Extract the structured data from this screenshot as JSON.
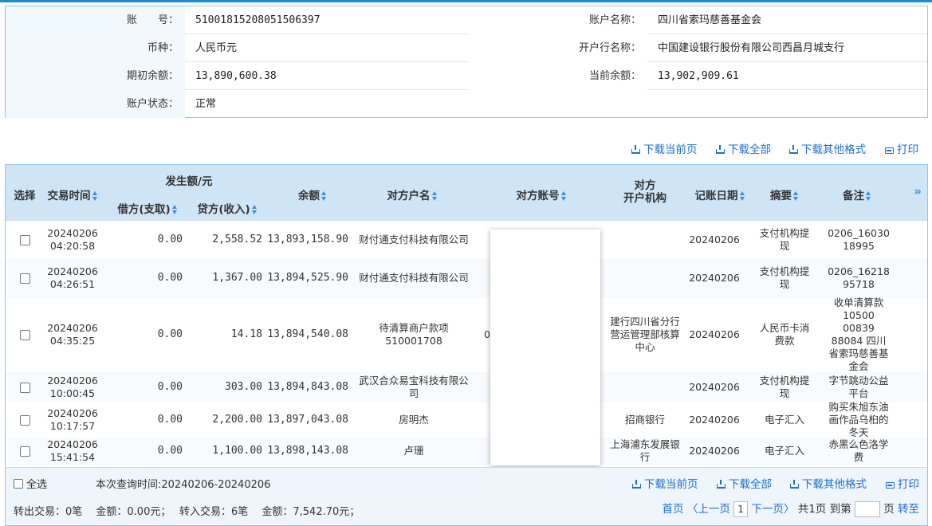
{
  "account": {
    "no_label": "账　　号：",
    "no_value": "51001815208051506397",
    "name_label": "账户名称：",
    "name_value": "四川省索玛慈善基金会",
    "currency_label": "币种：",
    "currency_value": "人民币元",
    "bank_label": "开户行名称：",
    "bank_value": "中国建设银行股份有限公司西昌月城支行",
    "opening_label": "期初余额：",
    "opening_value": "13,890,600.38",
    "current_label": "当前余额：",
    "current_value": "13,902,909.61",
    "status_label": "账户状态：",
    "status_value": "正常"
  },
  "toolbar": {
    "download_page": "下载当前页",
    "download_all": "下载全部",
    "download_other": "下载其他格式",
    "print": "打印"
  },
  "table": {
    "headers": {
      "select": "选择",
      "time": "交易时间",
      "amount_group": "发生额/元",
      "debit": "借方(支取)",
      "credit": "贷方(收入)",
      "balance": "余额",
      "party_name": "对方户名",
      "party_account": "对方账号",
      "party_bank_1": "对方",
      "party_bank_2": "开户机构",
      "post_date": "记账日期",
      "summary": "摘要",
      "remark": "备注",
      "expand": "»"
    },
    "rows": [
      {
        "date": "20240206",
        "time": "04:20:58",
        "debit": "0.00",
        "credit": "2,558.52",
        "balance": "13,893,158.90",
        "party": "财付通支付科技有限公司",
        "account": "",
        "bank": "",
        "post": "20240206",
        "summary": "支付机构提现",
        "remark": "0206_16030 18995"
      },
      {
        "date": "20240206",
        "time": "04:26:51",
        "debit": "0.00",
        "credit": "1,367.00",
        "balance": "13,894,525.90",
        "party": "财付通支付科技有限公司",
        "account": "",
        "bank": "",
        "post": "20240206",
        "summary": "支付机构提现",
        "remark": "0206_16218 95718"
      },
      {
        "date": "20240206",
        "time": "04:35:25",
        "debit": "0.00",
        "credit": "14.18",
        "balance": "13,894,540.08",
        "party": "待清算商户款项510001708",
        "account": "0",
        "bank": "建行四川省分行营运管理部核算中心",
        "post": "20240206",
        "summary": "人民币卡消费款",
        "remark": "收单清算款10500 00839 88084 四川省索玛慈善基金会"
      },
      {
        "date": "20240206",
        "time": "10:00:45",
        "debit": "0.00",
        "credit": "303.00",
        "balance": "13,894,843.08",
        "party": "武汉合众易宝科技有限公司",
        "account": "",
        "bank": "",
        "post": "20240206",
        "summary": "支付机构提现",
        "remark": "字节跳动公益平台"
      },
      {
        "date": "20240206",
        "time": "10:17:57",
        "debit": "0.00",
        "credit": "2,200.00",
        "balance": "13,897,043.08",
        "party": "房明杰",
        "account": "",
        "bank": "招商银行",
        "post": "20240206",
        "summary": "电子汇入",
        "remark": "购买朱旭东油画作品乌桕的冬天"
      },
      {
        "date": "20240206",
        "time": "15:41:54",
        "debit": "0.00",
        "credit": "1,100.00",
        "balance": "13,898,143.08",
        "party": "卢珊",
        "account": "",
        "bank": "上海浦东发展银行",
        "post": "20240206",
        "summary": "电子汇入",
        "remark": "赤黑么色洛学费"
      }
    ]
  },
  "footer": {
    "select_all": "全选",
    "query_time": "本次查询时间:20240206-20240206",
    "summary_text": "转出交易：0笔　 金额：0.00元；　 转入交易：6笔　 金额：7,542.70元；",
    "first": "首页",
    "prev": "〈上一页",
    "page": "1",
    "next": "下一页〉",
    "total": "共1页",
    "goto": "到第",
    "page_unit": "页",
    "go": "转至"
  }
}
